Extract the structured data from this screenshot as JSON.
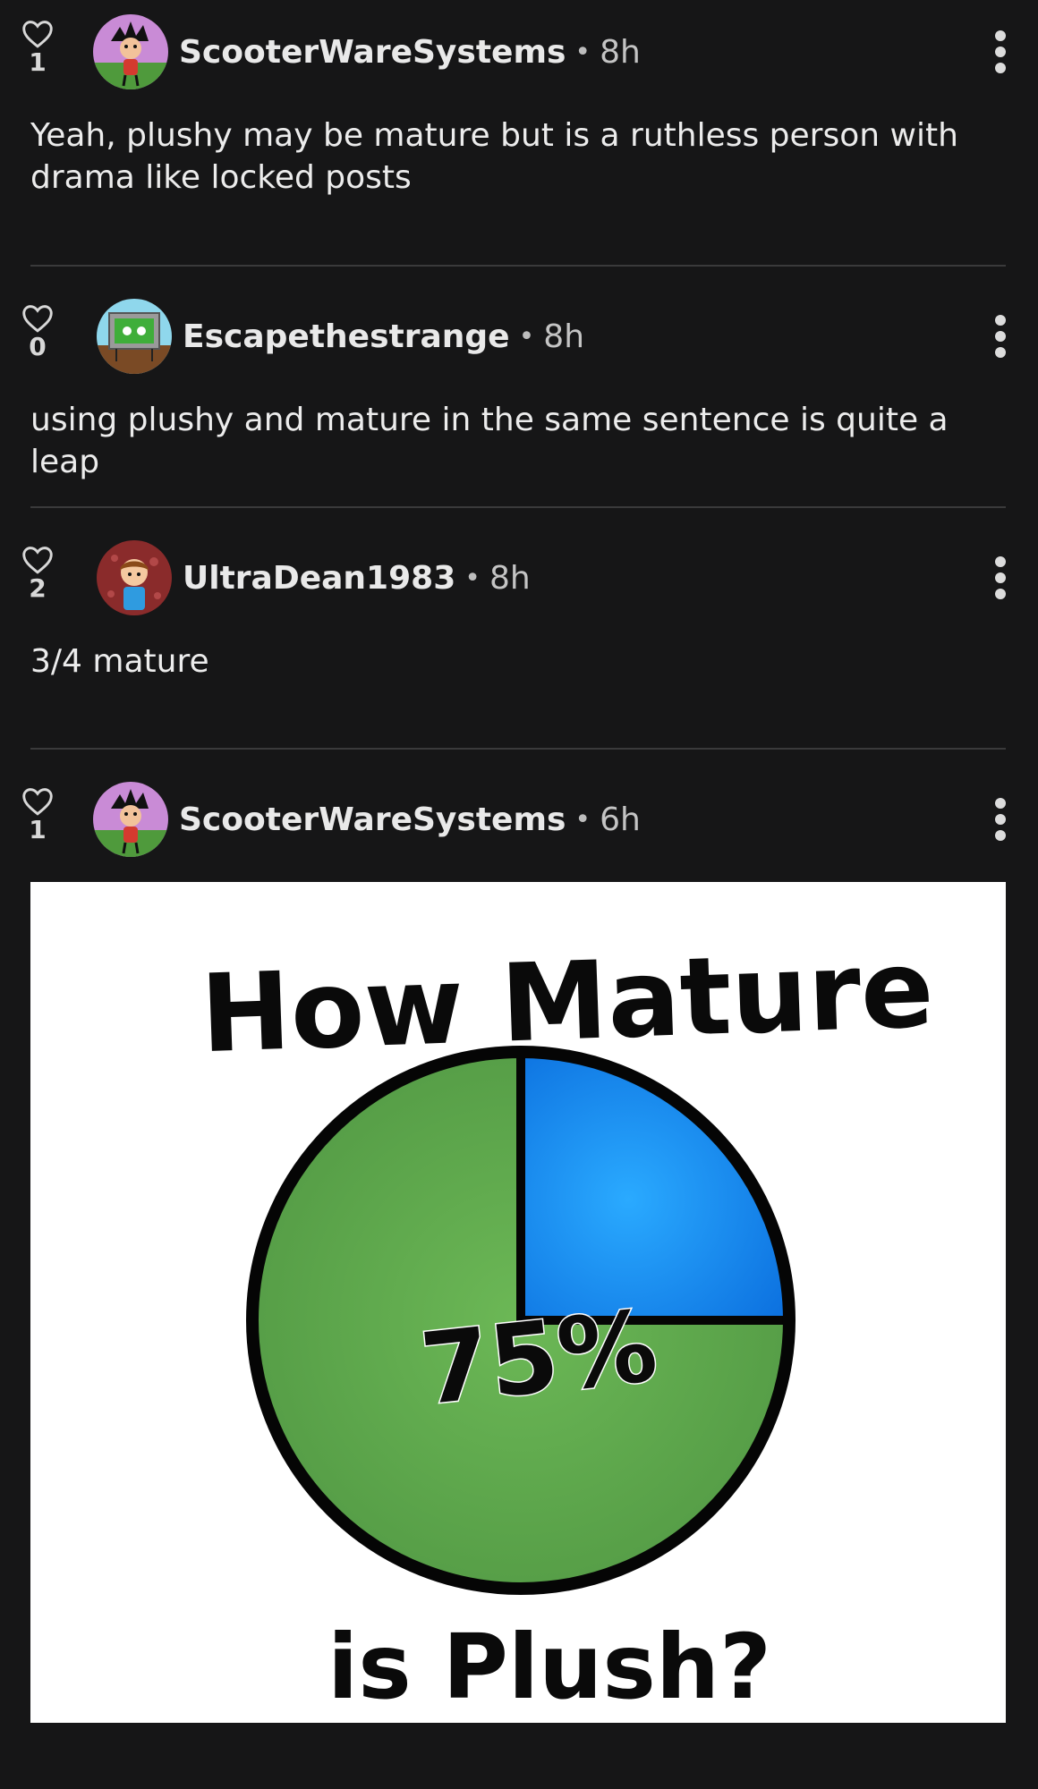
{
  "comments": [
    {
      "likes": "1",
      "username": "ScooterWareSystems",
      "separator": "•",
      "time": "8h",
      "text": "Yeah, plushy may be mature but is a ruthless person with drama like locked posts",
      "avatar_icon": "purple-green-character-avatar"
    },
    {
      "likes": "0",
      "username": "Escapethestrange",
      "separator": "•",
      "time": "8h",
      "text": "using plushy and mature in the same sentence is quite a leap",
      "avatar_icon": "sign-board-avatar"
    },
    {
      "likes": "2",
      "username": "UltraDean1983",
      "separator": "•",
      "time": "8h",
      "text": "3/4 mature",
      "avatar_icon": "brown-hair-character-avatar"
    },
    {
      "likes": "1",
      "username": "ScooterWareSystems",
      "separator": "•",
      "time": "6h",
      "avatar_icon": "purple-green-character-avatar",
      "image": {
        "title": "How Mature",
        "subtitle": "is Plush?",
        "center_label": "75%",
        "colors": {
          "mature": "#1a8cf2",
          "plush": "#5ca84a"
        }
      }
    }
  ],
  "chart_data": {
    "type": "pie",
    "title": "How Mature",
    "subtitle": "is Plush?",
    "center_label": "75%",
    "slices": [
      {
        "value": 25,
        "color": "#1a8cf2"
      },
      {
        "value": 75,
        "color": "#5ca84a"
      }
    ]
  },
  "colors": {
    "background": "#161617",
    "divider": "#3a3a3b",
    "text": "#ececec"
  }
}
